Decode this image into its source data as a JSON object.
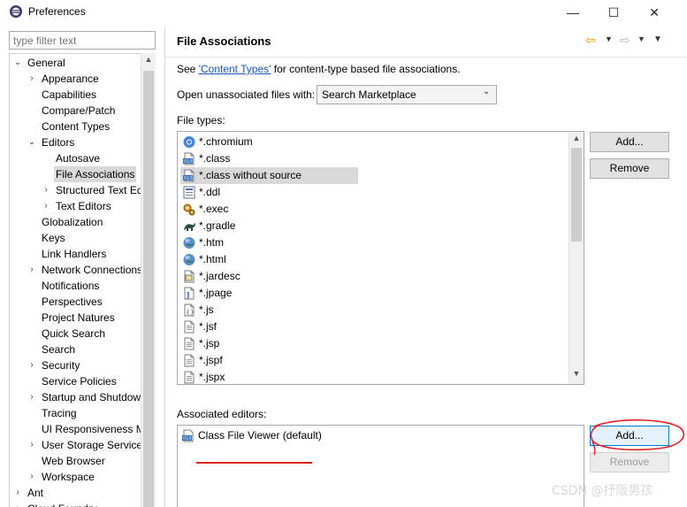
{
  "window": {
    "title": "Preferences",
    "controls": {
      "minimize": "—",
      "maximize": "☐",
      "close": "✕"
    }
  },
  "left": {
    "filter_placeholder": "type filter text",
    "tree": [
      {
        "label": "General",
        "level": 0,
        "twisty": "expanded"
      },
      {
        "label": "Appearance",
        "level": 1,
        "twisty": "collapsed"
      },
      {
        "label": "Capabilities",
        "level": 1,
        "twisty": "none"
      },
      {
        "label": "Compare/Patch",
        "level": 1,
        "twisty": "none"
      },
      {
        "label": "Content Types",
        "level": 1,
        "twisty": "none"
      },
      {
        "label": "Editors",
        "level": 1,
        "twisty": "expanded"
      },
      {
        "label": "Autosave",
        "level": 2,
        "twisty": "none"
      },
      {
        "label": "File Associations",
        "level": 2,
        "twisty": "none",
        "selected": true
      },
      {
        "label": "Structured Text Ed",
        "level": 2,
        "twisty": "collapsed"
      },
      {
        "label": "Text Editors",
        "level": 2,
        "twisty": "collapsed"
      },
      {
        "label": "Globalization",
        "level": 1,
        "twisty": "none"
      },
      {
        "label": "Keys",
        "level": 1,
        "twisty": "none"
      },
      {
        "label": "Link Handlers",
        "level": 1,
        "twisty": "none"
      },
      {
        "label": "Network Connections",
        "level": 1,
        "twisty": "collapsed"
      },
      {
        "label": "Notifications",
        "level": 1,
        "twisty": "none"
      },
      {
        "label": "Perspectives",
        "level": 1,
        "twisty": "none"
      },
      {
        "label": "Project Natures",
        "level": 1,
        "twisty": "none"
      },
      {
        "label": "Quick Search",
        "level": 1,
        "twisty": "none"
      },
      {
        "label": "Search",
        "level": 1,
        "twisty": "none"
      },
      {
        "label": "Security",
        "level": 1,
        "twisty": "collapsed"
      },
      {
        "label": "Service Policies",
        "level": 1,
        "twisty": "none"
      },
      {
        "label": "Startup and Shutdow",
        "level": 1,
        "twisty": "collapsed"
      },
      {
        "label": "Tracing",
        "level": 1,
        "twisty": "none"
      },
      {
        "label": "UI Responsiveness Mo",
        "level": 1,
        "twisty": "none"
      },
      {
        "label": "User Storage Service",
        "level": 1,
        "twisty": "collapsed"
      },
      {
        "label": "Web Browser",
        "level": 1,
        "twisty": "none"
      },
      {
        "label": "Workspace",
        "level": 1,
        "twisty": "collapsed"
      },
      {
        "label": "Ant",
        "level": 0,
        "twisty": "collapsed"
      },
      {
        "label": "Cloud Foundry",
        "level": 0,
        "twisty": "collapsed"
      }
    ]
  },
  "right": {
    "title": "File Associations",
    "see_prefix": "See ",
    "see_link": "'Content Types'",
    "see_suffix": " for content-type based file associations.",
    "open_label": "Open unassociated files with:",
    "open_value": "Search Marketplace",
    "file_types_label": "File types:",
    "file_types": [
      {
        "name": "*.chromium",
        "icon": "chromium-icon"
      },
      {
        "name": "*.class",
        "icon": "class-file-icon"
      },
      {
        "name": "*.class without source",
        "icon": "class-file-icon",
        "selected": true
      },
      {
        "name": "*.ddl",
        "icon": "ddl-file-icon"
      },
      {
        "name": "*.exec",
        "icon": "exec-gears-icon"
      },
      {
        "name": "*.gradle",
        "icon": "gradle-icon"
      },
      {
        "name": "*.htm",
        "icon": "web-globe-icon"
      },
      {
        "name": "*.html",
        "icon": "web-globe-icon"
      },
      {
        "name": "*.jardesc",
        "icon": "jardesc-icon"
      },
      {
        "name": "*.jpage",
        "icon": "jpage-icon"
      },
      {
        "name": "*.js",
        "icon": "js-file-icon"
      },
      {
        "name": "*.jsf",
        "icon": "text-file-icon"
      },
      {
        "name": "*.jsp",
        "icon": "text-file-icon"
      },
      {
        "name": "*.jspf",
        "icon": "text-file-icon"
      },
      {
        "name": "*.jspx",
        "icon": "text-file-icon"
      }
    ],
    "file_type_buttons": {
      "add": "Add...",
      "remove": "Remove"
    },
    "assoc_label": "Associated editors:",
    "assoc_editors": [
      {
        "name": "Class File Viewer (default)",
        "icon": "class-file-icon"
      }
    ],
    "assoc_buttons": {
      "add": "Add...",
      "remove": "Remove"
    }
  },
  "watermark": "CSDN @抒阪男孩",
  "colors": {
    "link": "#1a57b8",
    "selection": "#d9d9d9",
    "annotation": "#e02020",
    "nav_back": "#e8a100"
  }
}
